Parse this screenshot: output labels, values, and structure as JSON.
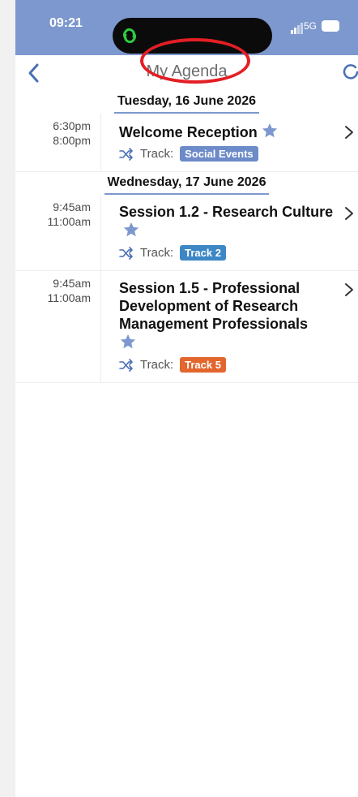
{
  "status": {
    "time": "09:21",
    "network": "5G"
  },
  "header": {
    "title": "My Agenda"
  },
  "agenda": {
    "day1": {
      "date": "Tuesday, 16 June 2026",
      "items": [
        {
          "start": "6:30pm",
          "end": "8:00pm",
          "title": "Welcome Reception",
          "track_label": "Track:",
          "track": "Social Events",
          "track_color": "#6d8bc8"
        }
      ]
    },
    "day2": {
      "date": "Wednesday, 17 June 2026",
      "items": [
        {
          "start": "9:45am",
          "end": "11:00am",
          "title": "Session 1.2 - Research Culture",
          "track_label": "Track:",
          "track": "Track 2",
          "track_color": "#3d87c6"
        },
        {
          "start": "9:45am",
          "end": "11:00am",
          "title": "Session 1.5 - Professional Development of Research Management Professionals",
          "track_label": "Track:",
          "track": "Track 5",
          "track_color": "#e2662d"
        }
      ]
    }
  },
  "icons": {
    "back": "chevron-left-icon",
    "favorite": "star-icon",
    "track": "shuffle-icon",
    "open": "chevron-right-icon",
    "app": "link-icon"
  }
}
